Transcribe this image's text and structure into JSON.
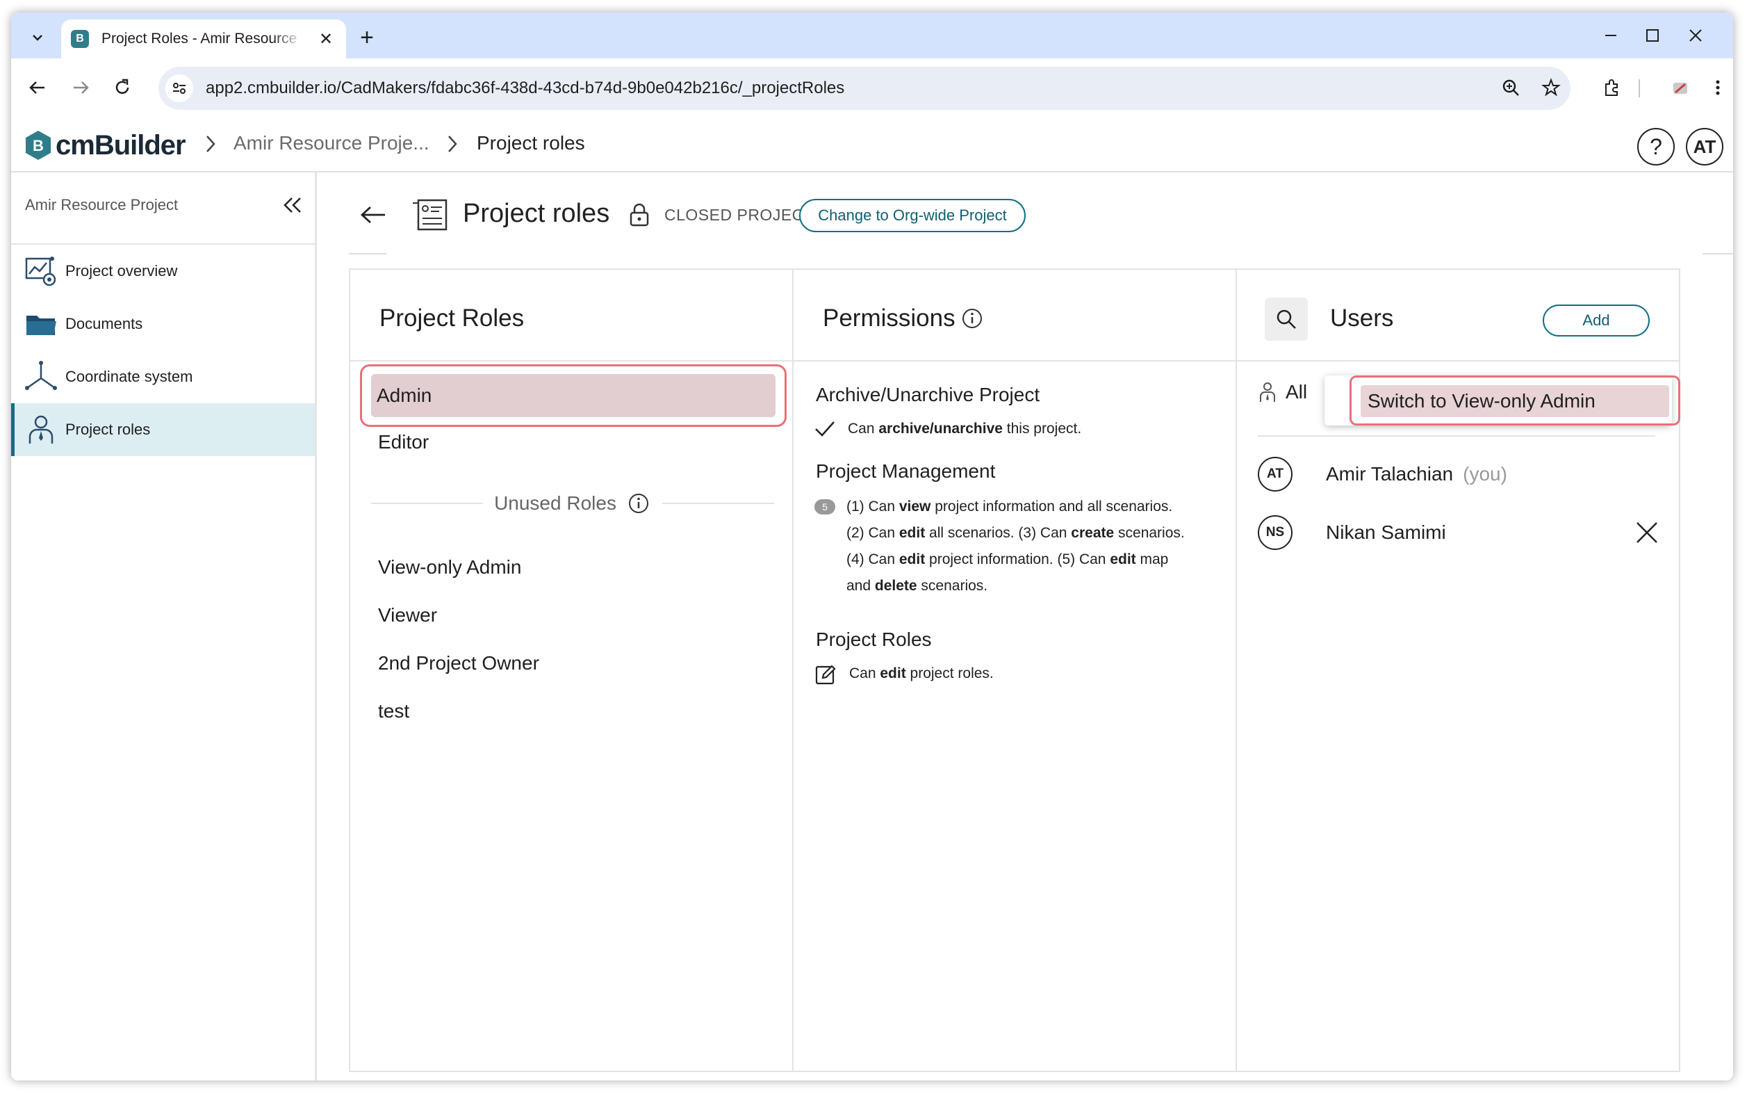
{
  "browser": {
    "tab_title": "Project Roles - Amir Resource P",
    "favicon_letter": "B",
    "new_tab_label": "+",
    "close_tab_label": "✕",
    "url": "app2.cmbuilder.io/CadMakers/fdabc36f-438d-43cd-b74d-9b0e042b216c/_projectRoles"
  },
  "header": {
    "logo_text": "cmBuilder",
    "breadcrumb": [
      "Amir Resource Proje...",
      "Project roles"
    ],
    "help_label": "?",
    "user_initials": "AT"
  },
  "sidebar": {
    "title": "Amir Resource Project",
    "items": [
      {
        "label": "Project overview",
        "icon": "overview-icon"
      },
      {
        "label": "Documents",
        "icon": "folder-icon"
      },
      {
        "label": "Coordinate system",
        "icon": "axes-icon"
      },
      {
        "label": "Project roles",
        "icon": "user-role-icon",
        "active": true
      }
    ]
  },
  "page": {
    "title": "Project roles",
    "status": "CLOSED PROJECT",
    "change_button": "Change to Org-wide Project"
  },
  "roles_panel": {
    "title": "Project Roles",
    "active_roles": [
      "Admin",
      "Editor"
    ],
    "unused_label": "Unused Roles",
    "unused_roles": [
      "View-only Admin",
      "Viewer",
      "2nd Project Owner",
      "test"
    ]
  },
  "permissions_panel": {
    "title": "Permissions",
    "sections": [
      {
        "title": "Archive/Unarchive Project"
      },
      {
        "title": "Project Management",
        "badge": "5"
      },
      {
        "title": "Project Roles"
      }
    ],
    "archive_text": {
      "a": "Can ",
      "b": "archive/unarchive",
      "c": " this project."
    },
    "mgmt_line1": {
      "a": "(1) Can ",
      "b": "view",
      "c": " project information and all scenarios."
    },
    "mgmt_line2": {
      "a": "(2) Can ",
      "b": "edit",
      "c": " all scenarios. (3) Can ",
      "d": "create",
      "e": " scenarios."
    },
    "mgmt_line3": {
      "a": "(4) Can ",
      "b": "edit",
      "c": " project information. (5) Can ",
      "d": "edit",
      "e": " map"
    },
    "mgmt_line4": {
      "a": "and ",
      "b": "delete",
      "c": " scenarios."
    },
    "roles_text": {
      "a": "Can ",
      "b": "edit",
      "c": " project roles."
    }
  },
  "users_panel": {
    "title": "Users",
    "add_button": "Add",
    "filter_label": "All",
    "menu_item": "Switch to View-only Admin",
    "users": [
      {
        "initials": "AT",
        "name": "Amir Talachian",
        "suffix": "(you)"
      },
      {
        "initials": "NS",
        "name": "Nikan Samimi"
      }
    ]
  },
  "colors": {
    "accent": "#0f6f84",
    "highlight_border": "#e8707a",
    "selected_bg": "#e2cdd0",
    "tabstrip": "#d3e3fd"
  }
}
